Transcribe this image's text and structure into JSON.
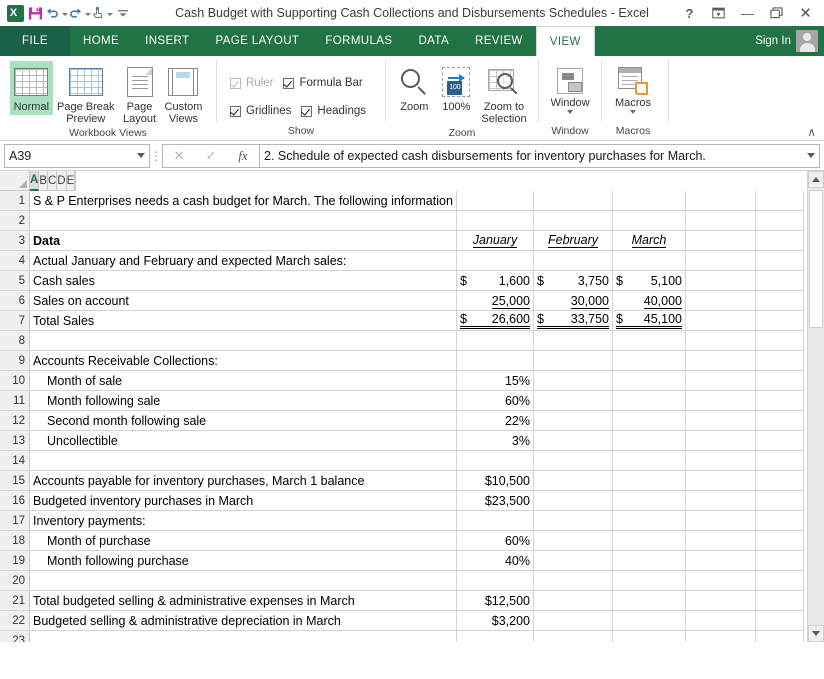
{
  "window": {
    "title": "Cash Budget with Supporting Cash Collections and Disbursements Schedules - Excel",
    "help_label": "?",
    "ribbon_display_label": "⤒",
    "minimize_label": "—",
    "restore_label": "❐",
    "close_label": "✕"
  },
  "quick_access": {
    "app_icon": "excel-logo-icon",
    "items": [
      {
        "name": "save-icon",
        "label": "Save"
      },
      {
        "name": "undo-icon",
        "label": "Undo"
      },
      {
        "name": "redo-icon",
        "label": "Redo"
      },
      {
        "name": "touch-mouse-mode-icon",
        "label": "Touch/Mouse Mode"
      },
      {
        "name": "customize-quick-access-icon",
        "label": "Customize Quick Access Toolbar"
      }
    ]
  },
  "tabs": {
    "file_label": "FILE",
    "items": [
      {
        "label": "HOME",
        "active": false
      },
      {
        "label": "INSERT",
        "active": false
      },
      {
        "label": "PAGE LAYOUT",
        "active": false
      },
      {
        "label": "FORMULAS",
        "active": false
      },
      {
        "label": "DATA",
        "active": false
      },
      {
        "label": "REVIEW",
        "active": false
      },
      {
        "label": "VIEW",
        "active": true
      }
    ],
    "sign_in_label": "Sign In"
  },
  "ribbon": {
    "groups": [
      {
        "label": "Workbook Views",
        "buttons": [
          {
            "label": "Normal",
            "selected": true
          },
          {
            "label": "Page Break\nPreview",
            "line1": "Page Break",
            "line2": "Preview",
            "selected": false
          },
          {
            "label": "Page\nLayout",
            "line1": "Page",
            "line2": "Layout",
            "selected": false
          },
          {
            "label": "Custom\nViews",
            "line1": "Custom",
            "line2": "Views",
            "selected": false
          }
        ]
      },
      {
        "label": "Show",
        "checkboxes": [
          {
            "label": "Ruler",
            "checked": true,
            "disabled": true
          },
          {
            "label": "Formula Bar",
            "checked": true,
            "disabled": false
          },
          {
            "label": "Gridlines",
            "checked": true,
            "disabled": false
          },
          {
            "label": "Headings",
            "checked": true,
            "disabled": false
          }
        ]
      },
      {
        "label": "Zoom",
        "buttons": [
          {
            "label": "Zoom"
          },
          {
            "label": "100%"
          },
          {
            "line1": "Zoom to",
            "line2": "Selection"
          }
        ]
      },
      {
        "label": "Window",
        "buttons": [
          {
            "label": "Window",
            "has_caret": true
          }
        ]
      },
      {
        "label": "Macros",
        "buttons": [
          {
            "label": "Macros",
            "has_caret": true
          }
        ]
      }
    ],
    "collapse_label": "∧"
  },
  "formula_bar": {
    "name_box_value": "A39",
    "cancel_label": "✕",
    "enter_label": "✓",
    "insert_function_label": "fx",
    "formula_value": "2. Schedule of expected cash disbursements for inventory purchases for March."
  },
  "sheet": {
    "columns": [
      {
        "label": "A",
        "active": true,
        "cls": "w-a"
      },
      {
        "label": "B",
        "active": false,
        "cls": "w-b"
      },
      {
        "label": "C",
        "active": false,
        "cls": "w-c"
      },
      {
        "label": "D",
        "active": false,
        "cls": "w-d"
      },
      {
        "label": "E",
        "active": false,
        "cls": "w-e"
      },
      {
        "label": "",
        "active": false,
        "cls": "w-f"
      }
    ],
    "row_numbers": [
      1,
      2,
      3,
      4,
      5,
      6,
      7,
      8,
      9,
      10,
      11,
      12,
      13,
      14,
      15,
      16,
      17,
      18,
      19,
      20,
      21,
      22,
      23
    ],
    "rows": [
      {
        "n": 1,
        "a": "S & P Enterprises needs a cash budget for March. The following information is available.",
        "a_spill": true,
        "b": "",
        "c": "",
        "d": ""
      },
      {
        "n": 2,
        "a": "",
        "b": "",
        "c": "",
        "d": ""
      },
      {
        "n": 3,
        "a": "Data",
        "a_bold": true,
        "b": "January",
        "c": "February",
        "d": "March",
        "style": "month-header"
      },
      {
        "n": 4,
        "a": "Actual January and February and expected March sales:",
        "a_spill": true,
        "b": "",
        "c": "",
        "d": ""
      },
      {
        "n": 5,
        "a": "Cash sales",
        "b": "1,600",
        "c": "3,750",
        "d": "5,100",
        "currency": true
      },
      {
        "n": 6,
        "a": "Sales on account",
        "b": "25,000",
        "c": "30,000",
        "d": "40,000",
        "underline": "single"
      },
      {
        "n": 7,
        "a": "Total Sales",
        "b": "26,600",
        "c": "33,750",
        "d": "45,100",
        "currency": true,
        "underline": "double"
      },
      {
        "n": 8,
        "a": "",
        "b": "",
        "c": "",
        "d": ""
      },
      {
        "n": 9,
        "a": "Accounts Receivable Collections:",
        "a_spill": true,
        "b": "",
        "c": "",
        "d": ""
      },
      {
        "n": 10,
        "a": "Month of sale",
        "indent": 1,
        "b": "15%",
        "b_align": "right",
        "c": "",
        "d": ""
      },
      {
        "n": 11,
        "a": "Month following sale",
        "indent": 1,
        "b": "60%",
        "b_align": "right",
        "c": "",
        "d": ""
      },
      {
        "n": 12,
        "a": "Second month following sale",
        "indent": 1,
        "b": "22%",
        "b_align": "right",
        "c": "",
        "d": ""
      },
      {
        "n": 13,
        "a": "Uncollectible",
        "indent": 1,
        "b": "3%",
        "b_align": "right",
        "c": "",
        "d": ""
      },
      {
        "n": 14,
        "a": "",
        "b": "",
        "c": "",
        "d": ""
      },
      {
        "n": 15,
        "a": "Accounts payable for inventory purchases, March 1 balance",
        "b": "$10,500",
        "b_align": "right",
        "c": "",
        "d": ""
      },
      {
        "n": 16,
        "a": "Budgeted inventory purchases in March",
        "b": "$23,500",
        "b_align": "right",
        "c": "",
        "d": ""
      },
      {
        "n": 17,
        "a": "Inventory payments:",
        "b": "",
        "c": "",
        "d": ""
      },
      {
        "n": 18,
        "a": "Month of purchase",
        "indent": 1,
        "b": "60%",
        "b_align": "right",
        "c": "",
        "d": ""
      },
      {
        "n": 19,
        "a": "Month following purchase",
        "indent": 1,
        "b": "40%",
        "b_align": "right",
        "c": "",
        "d": ""
      },
      {
        "n": 20,
        "a": "",
        "b": "",
        "c": "",
        "d": ""
      },
      {
        "n": 21,
        "a": "Total budgeted selling & administrative expenses in March",
        "b": "$12,500",
        "b_align": "right",
        "c": "",
        "d": ""
      },
      {
        "n": 22,
        "a": "Budgeted selling & administrative depreciation in March",
        "b": "$3,200",
        "b_align": "right",
        "c": "",
        "d": ""
      },
      {
        "n": 23,
        "a": "",
        "b": "",
        "c": "",
        "d": ""
      }
    ],
    "currency_symbol": "$"
  },
  "scrollbar": {
    "up_label": "▲",
    "down_label": "▼"
  },
  "colors": {
    "brand_green": "#217346",
    "active_tab_text": "#217346",
    "selected_button_bg": "#a9e0c0",
    "grid_line": "#d4d4d4",
    "header_bg": "#f0f0f0"
  }
}
